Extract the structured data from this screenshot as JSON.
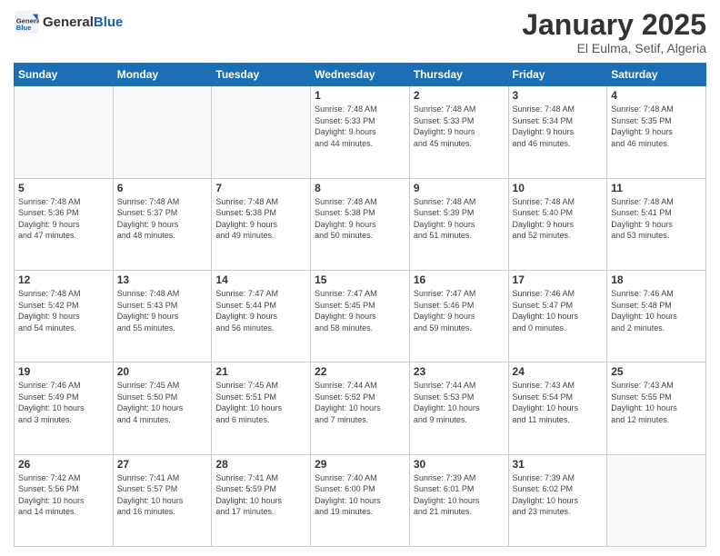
{
  "logo": {
    "general": "General",
    "blue": "Blue"
  },
  "header": {
    "title": "January 2025",
    "subtitle": "El Eulma, Setif, Algeria"
  },
  "weekdays": [
    "Sunday",
    "Monday",
    "Tuesday",
    "Wednesday",
    "Thursday",
    "Friday",
    "Saturday"
  ],
  "weeks": [
    [
      {
        "day": "",
        "info": ""
      },
      {
        "day": "",
        "info": ""
      },
      {
        "day": "",
        "info": ""
      },
      {
        "day": "1",
        "info": "Sunrise: 7:48 AM\nSunset: 5:33 PM\nDaylight: 9 hours\nand 44 minutes."
      },
      {
        "day": "2",
        "info": "Sunrise: 7:48 AM\nSunset: 5:33 PM\nDaylight: 9 hours\nand 45 minutes."
      },
      {
        "day": "3",
        "info": "Sunrise: 7:48 AM\nSunset: 5:34 PM\nDaylight: 9 hours\nand 46 minutes."
      },
      {
        "day": "4",
        "info": "Sunrise: 7:48 AM\nSunset: 5:35 PM\nDaylight: 9 hours\nand 46 minutes."
      }
    ],
    [
      {
        "day": "5",
        "info": "Sunrise: 7:48 AM\nSunset: 5:36 PM\nDaylight: 9 hours\nand 47 minutes."
      },
      {
        "day": "6",
        "info": "Sunrise: 7:48 AM\nSunset: 5:37 PM\nDaylight: 9 hours\nand 48 minutes."
      },
      {
        "day": "7",
        "info": "Sunrise: 7:48 AM\nSunset: 5:38 PM\nDaylight: 9 hours\nand 49 minutes."
      },
      {
        "day": "8",
        "info": "Sunrise: 7:48 AM\nSunset: 5:38 PM\nDaylight: 9 hours\nand 50 minutes."
      },
      {
        "day": "9",
        "info": "Sunrise: 7:48 AM\nSunset: 5:39 PM\nDaylight: 9 hours\nand 51 minutes."
      },
      {
        "day": "10",
        "info": "Sunrise: 7:48 AM\nSunset: 5:40 PM\nDaylight: 9 hours\nand 52 minutes."
      },
      {
        "day": "11",
        "info": "Sunrise: 7:48 AM\nSunset: 5:41 PM\nDaylight: 9 hours\nand 53 minutes."
      }
    ],
    [
      {
        "day": "12",
        "info": "Sunrise: 7:48 AM\nSunset: 5:42 PM\nDaylight: 9 hours\nand 54 minutes."
      },
      {
        "day": "13",
        "info": "Sunrise: 7:48 AM\nSunset: 5:43 PM\nDaylight: 9 hours\nand 55 minutes."
      },
      {
        "day": "14",
        "info": "Sunrise: 7:47 AM\nSunset: 5:44 PM\nDaylight: 9 hours\nand 56 minutes."
      },
      {
        "day": "15",
        "info": "Sunrise: 7:47 AM\nSunset: 5:45 PM\nDaylight: 9 hours\nand 58 minutes."
      },
      {
        "day": "16",
        "info": "Sunrise: 7:47 AM\nSunset: 5:46 PM\nDaylight: 9 hours\nand 59 minutes."
      },
      {
        "day": "17",
        "info": "Sunrise: 7:46 AM\nSunset: 5:47 PM\nDaylight: 10 hours\nand 0 minutes."
      },
      {
        "day": "18",
        "info": "Sunrise: 7:46 AM\nSunset: 5:48 PM\nDaylight: 10 hours\nand 2 minutes."
      }
    ],
    [
      {
        "day": "19",
        "info": "Sunrise: 7:46 AM\nSunset: 5:49 PM\nDaylight: 10 hours\nand 3 minutes."
      },
      {
        "day": "20",
        "info": "Sunrise: 7:45 AM\nSunset: 5:50 PM\nDaylight: 10 hours\nand 4 minutes."
      },
      {
        "day": "21",
        "info": "Sunrise: 7:45 AM\nSunset: 5:51 PM\nDaylight: 10 hours\nand 6 minutes."
      },
      {
        "day": "22",
        "info": "Sunrise: 7:44 AM\nSunset: 5:52 PM\nDaylight: 10 hours\nand 7 minutes."
      },
      {
        "day": "23",
        "info": "Sunrise: 7:44 AM\nSunset: 5:53 PM\nDaylight: 10 hours\nand 9 minutes."
      },
      {
        "day": "24",
        "info": "Sunrise: 7:43 AM\nSunset: 5:54 PM\nDaylight: 10 hours\nand 11 minutes."
      },
      {
        "day": "25",
        "info": "Sunrise: 7:43 AM\nSunset: 5:55 PM\nDaylight: 10 hours\nand 12 minutes."
      }
    ],
    [
      {
        "day": "26",
        "info": "Sunrise: 7:42 AM\nSunset: 5:56 PM\nDaylight: 10 hours\nand 14 minutes."
      },
      {
        "day": "27",
        "info": "Sunrise: 7:41 AM\nSunset: 5:57 PM\nDaylight: 10 hours\nand 16 minutes."
      },
      {
        "day": "28",
        "info": "Sunrise: 7:41 AM\nSunset: 5:59 PM\nDaylight: 10 hours\nand 17 minutes."
      },
      {
        "day": "29",
        "info": "Sunrise: 7:40 AM\nSunset: 6:00 PM\nDaylight: 10 hours\nand 19 minutes."
      },
      {
        "day": "30",
        "info": "Sunrise: 7:39 AM\nSunset: 6:01 PM\nDaylight: 10 hours\nand 21 minutes."
      },
      {
        "day": "31",
        "info": "Sunrise: 7:39 AM\nSunset: 6:02 PM\nDaylight: 10 hours\nand 23 minutes."
      },
      {
        "day": "",
        "info": ""
      }
    ]
  ]
}
